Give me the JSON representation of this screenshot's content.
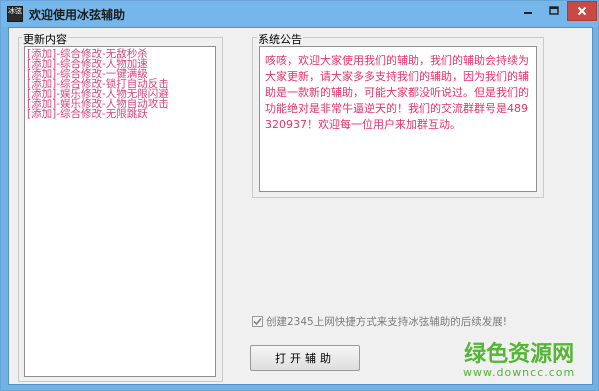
{
  "window": {
    "title": "欢迎使用冰弦辅助",
    "app_icon": "冰弦"
  },
  "updates": {
    "label": "更新内容",
    "items": [
      "[添加]-综合修改-无敌秒杀",
      "[添加]-综合修改-人物加速",
      "[添加]-综合修改-一键满级",
      "[添加]-综合修改-锁打自动反击",
      "[添加]-娱乐修改-人物无限闪避",
      "[添加]-娱乐修改-人物自动攻击",
      "[添加]-综合修改-无限跳跃"
    ]
  },
  "notice": {
    "label": "系统公告",
    "text": "咳咳，欢迎大家使用我们的辅助，我们的辅助会持续为大家更新，请大家多多支持我们的辅助，因为我们的辅助是一款新的辅助，可能大家都没听说过。但是我们的功能绝对是非常牛逼逆天的！我们的交流群群号是489320937！欢迎每一位用户来加群互动。"
  },
  "options": {
    "shortcut_label": "创建2345上网快捷方式来支持冰弦辅助的后续发展!",
    "shortcut_checked": true
  },
  "actions": {
    "open_label": "打开辅助"
  },
  "watermark": {
    "name": "绿色资源网",
    "url": "www.downcc.com"
  },
  "colors": {
    "accent": "#75b7ea",
    "list_text": "#d9427c",
    "notice_text": "#e5326a",
    "watermark": "#55b534",
    "close_button": "#c74a44"
  }
}
